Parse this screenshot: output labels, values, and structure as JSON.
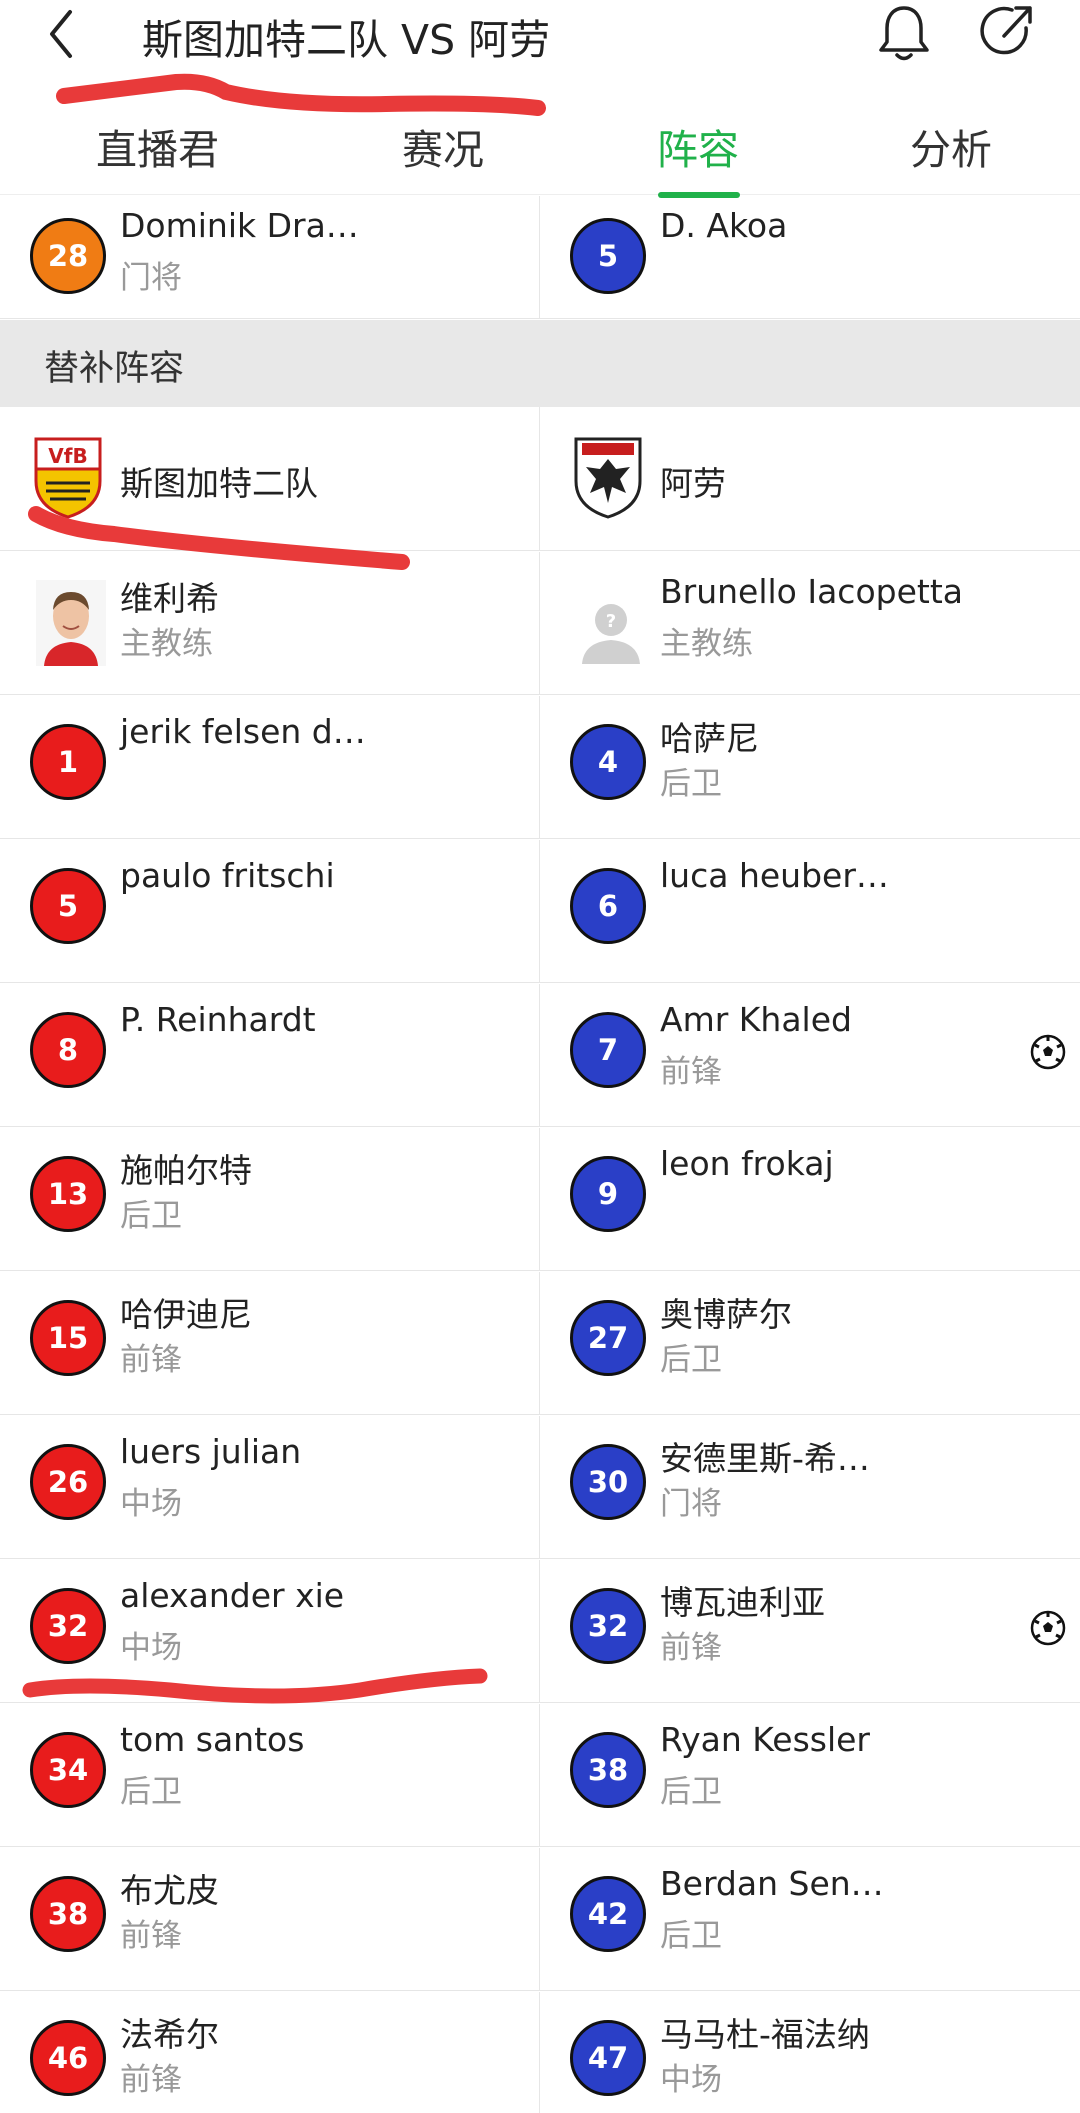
{
  "header": {
    "title": "斯图加特二队 VS 阿劳",
    "back_icon": "back-chevron-icon",
    "bell_icon": "bell-icon",
    "share_icon": "share-icon"
  },
  "tabs": [
    {
      "label": "直播君",
      "active": false
    },
    {
      "label": "赛况",
      "active": false
    },
    {
      "label": "阵容",
      "active": true
    },
    {
      "label": "分析",
      "active": false
    }
  ],
  "colors": {
    "accent": "#20b14a",
    "home_badge": "#e81c1c",
    "away_badge": "#2a3fc7",
    "goalkeeper_badge": "#f07c14",
    "annotation": "#e83a3a"
  },
  "top_row": {
    "home": {
      "number": "28",
      "name": "Dominik Dra…",
      "position": "门将"
    },
    "away": {
      "number": "5",
      "name": "D. Akoa",
      "position": ""
    }
  },
  "bench": {
    "title": "替补阵容",
    "teams": {
      "home": "斯图加特二队",
      "away": "阿劳"
    },
    "coaches": {
      "home": {
        "name": "维利希",
        "role": "主教练"
      },
      "away": {
        "name": "Brunello Iacopetta",
        "role": "主教练"
      }
    },
    "players": [
      {
        "home": {
          "number": "1",
          "name": "jerik felsen d…",
          "position": ""
        },
        "away": {
          "number": "4",
          "name": "哈萨尼",
          "position": "后卫",
          "goal": false
        }
      },
      {
        "home": {
          "number": "5",
          "name": "paulo fritschi",
          "position": ""
        },
        "away": {
          "number": "6",
          "name": "luca heuber…",
          "position": "",
          "goal": false
        }
      },
      {
        "home": {
          "number": "8",
          "name": "P. Reinhardt",
          "position": ""
        },
        "away": {
          "number": "7",
          "name": "Amr Khaled",
          "position": "前锋",
          "goal": true
        }
      },
      {
        "home": {
          "number": "13",
          "name": "施帕尔特",
          "position": "后卫"
        },
        "away": {
          "number": "9",
          "name": "leon frokaj",
          "position": "",
          "goal": false
        }
      },
      {
        "home": {
          "number": "15",
          "name": "哈伊迪尼",
          "position": "前锋"
        },
        "away": {
          "number": "27",
          "name": "奥博萨尔",
          "position": "后卫",
          "goal": false
        }
      },
      {
        "home": {
          "number": "26",
          "name": "luers julian",
          "position": "中场"
        },
        "away": {
          "number": "30",
          "name": "安德里斯-希…",
          "position": "门将",
          "goal": false
        }
      },
      {
        "home": {
          "number": "32",
          "name": "alexander xie",
          "position": "中场"
        },
        "away": {
          "number": "32",
          "name": "博瓦迪利亚",
          "position": "前锋",
          "goal": true
        }
      },
      {
        "home": {
          "number": "34",
          "name": "tom santos",
          "position": "后卫"
        },
        "away": {
          "number": "38",
          "name": "Ryan Kessler",
          "position": "后卫",
          "goal": false
        }
      },
      {
        "home": {
          "number": "38",
          "name": "布尤皮",
          "position": "前锋"
        },
        "away": {
          "number": "42",
          "name": "Berdan Sen…",
          "position": "后卫",
          "goal": false
        }
      },
      {
        "home": {
          "number": "46",
          "name": "法希尔",
          "position": "前锋"
        },
        "away": {
          "number": "47",
          "name": "马马杜-福法纳",
          "position": "中场",
          "goal": false
        }
      }
    ]
  }
}
